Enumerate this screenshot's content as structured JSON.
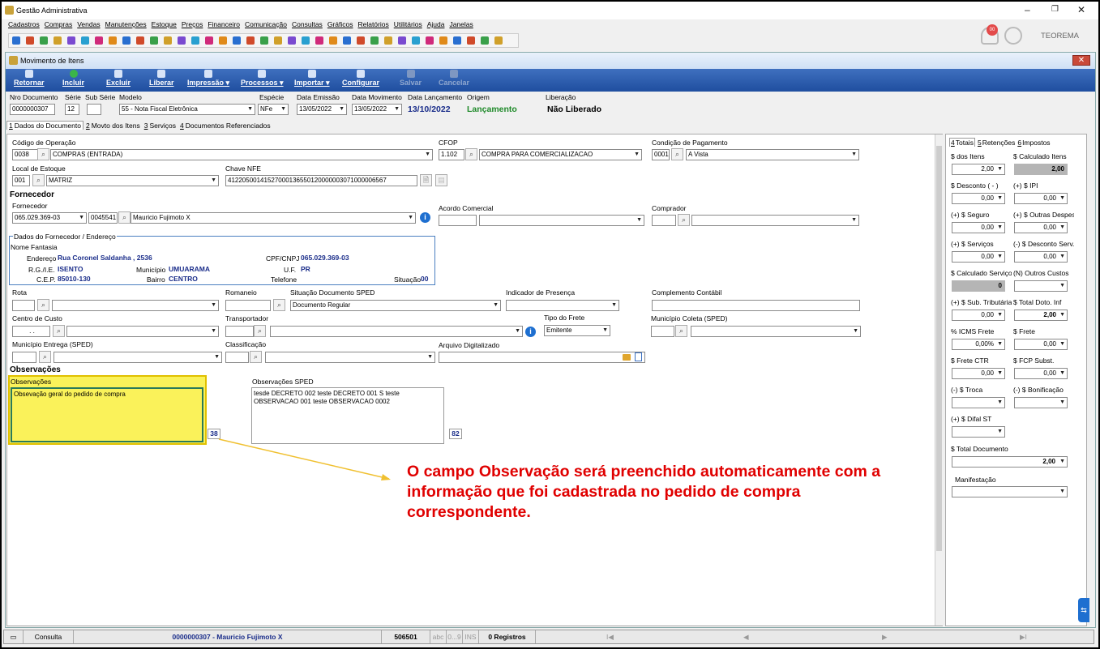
{
  "window": {
    "title": "Gestão Administrativa",
    "brand": "TEOREMA",
    "minimize": "–",
    "maximize": "❐",
    "close": "✕"
  },
  "menu": [
    "Cadastros",
    "Compras",
    "Vendas",
    "Manutenções",
    "Estoque",
    "Preços",
    "Financeiro",
    "Comunicação",
    "Consultas",
    "Gráficos",
    "Relatórios",
    "Utilitários",
    "Ajuda",
    "Janelas"
  ],
  "notif_badge": "00",
  "subwindow": {
    "title": "Movimento de Itens",
    "close": "✕"
  },
  "ribbon": {
    "retornar": "Retornar",
    "incluir": "Incluir",
    "excluir": "Excluir",
    "liberar": "Liberar",
    "impressao": "Impressão",
    "processos": "Processos",
    "importar": "Importar",
    "configurar": "Configurar",
    "salvar": "Salvar",
    "cancelar": "Cancelar"
  },
  "header": {
    "nro_label": "Nro Documento",
    "nro": "0000000307",
    "serie_label": "Série",
    "serie": "12",
    "subserie_label": "Sub Série",
    "subserie": "",
    "modelo_label": "Modelo",
    "modelo": "55 - Nota Fiscal Eletrônica",
    "especie_label": "Espécie",
    "especie": "NFe",
    "emissao_label": "Data Emissão",
    "emissao": "13/05/2022",
    "movimento_label": "Data Movimento",
    "movimento": "13/05/2022",
    "lancamento_label": "Data Lançamento",
    "lancamento": "13/10/2022",
    "origem_label": "Origem",
    "origem": "Lançamento",
    "liberacao_label": "Liberação",
    "liberacao": "Não Liberado"
  },
  "tabs": [
    {
      "key": "1",
      "label": "Dados do Documento"
    },
    {
      "key": "2",
      "label": "Movto dos Itens"
    },
    {
      "key": "3",
      "label": "Serviços"
    },
    {
      "key": "4",
      "label": "Documentos Referenciados"
    }
  ],
  "form": {
    "codop_label": "Código de Operação",
    "codop_code": "0038",
    "codop_desc": "COMPRAS (ENTRADA)",
    "cfop_label": "CFOP",
    "cfop_code": "1.102",
    "cfop_desc": "COMPRA PARA COMERCIALIZACAO",
    "condpag_label": "Condição de Pagamento",
    "condpag_code": "0001",
    "condpag_desc": "A Vista",
    "local_label": "Local de Estoque",
    "local_code": "001",
    "local_desc": "MATRIZ",
    "chave_label": "Chave NFE",
    "chave": "41220500141527000136550120000003071000006567",
    "fornecedor_title": "Fornecedor",
    "fornecedor_label": "Fornecedor",
    "forn_cnpj": "065.029.369-03",
    "forn_code": "0045541",
    "forn_name": "Mauricio Fujimoto X",
    "acordo_label": "Acordo Comercial",
    "comprador_label": "Comprador",
    "dados_title": "Dados do Fornecedor / Endereço",
    "nome_fantasia": "Nome Fantasia",
    "endereco_label": "Endereço",
    "endereco": "Rua Coronel Saldanha , 2536",
    "cpf_label": "CPF/CNPJ",
    "cpf": "065.029.369-03",
    "rg_label": "R.G./I.E.",
    "rg": "ISENTO",
    "municipio_label": "Município",
    "municipio": "UMUARAMA",
    "uf_label": "U.F.",
    "uf": "PR",
    "cep_label": "C.E.P.",
    "cep": "85010-130",
    "bairro_label": "Bairro",
    "bairro": "CENTRO",
    "telefone_label": "Telefone",
    "situacao_label": "Situação",
    "situacao": "00",
    "rota_label": "Rota",
    "romaneio_label": "Romaneio",
    "sitsped_label": "Situação Documento SPED",
    "sitsped": "Documento Regular",
    "indpres_label": "Indicador de Presença",
    "complemento_label": "Complemento Contábil",
    "ccusto_label": "Centro de Custo",
    "ccusto": ". .",
    "transp_label": "Transportador",
    "tipofrete_label": "Tipo do Frete",
    "tipofrete": "Emitente",
    "muncoleta_label": "Município Coleta (SPED)",
    "munentrega_label": "Município Entrega (SPED)",
    "classif_label": "Classificação",
    "arquivo_label": "Arquivo Digitalizado",
    "obs_title": "Observações",
    "obs_label": "Observações",
    "obs_text": "Obsevação geral do pedido de compra",
    "obs_count": "38",
    "obssped_label": "Observações SPED",
    "obssped_text": "tesde DECRETO 002 teste DECRETO 001 S   teste OBSERVACAO 001 teste OBSERVACAO 0002",
    "obssped_count": "82"
  },
  "annotation": "O campo Observação será preenchido automaticamente com a informação que foi cadastrada no pedido de compra correspondente.",
  "right": {
    "tabs": [
      {
        "key": "4",
        "label": "Totais"
      },
      {
        "key": "5",
        "label": "Retenções"
      },
      {
        "key": "6",
        "label": "Impostos"
      }
    ],
    "fields": [
      {
        "label": "$ dos Itens",
        "value": "2,00",
        "drop": true
      },
      {
        "label": "$ Calculado Itens",
        "value": "2,00",
        "readonly": true
      },
      {
        "label": "$ Desconto ( - )",
        "value": "0,00",
        "drop": true
      },
      {
        "label": "(+) $ IPI",
        "value": "0,00",
        "drop": true
      },
      {
        "label": "(+) $ Seguro",
        "value": "0,00",
        "drop": true
      },
      {
        "label": "(+) $ Outras Despesas",
        "value": "0,00",
        "drop": true
      },
      {
        "label": "(+) $ Serviços",
        "value": "0,00",
        "drop": true
      },
      {
        "label": "(-) $ Desconto Serv.",
        "value": "0,00",
        "drop": true
      },
      {
        "label": "$ Calculado Serviços",
        "value": "0",
        "readonly": true
      },
      {
        "label": "(N) Outros Custos",
        "value": "",
        "drop": true
      },
      {
        "label": "(+) $ Sub. Tributária",
        "value": "0,00",
        "drop": true
      },
      {
        "label": "$ Total Doto. Inf",
        "value": "2,00",
        "drop": true,
        "bold": true
      },
      {
        "label": "% ICMS Frete",
        "value": "0,00%",
        "drop": true
      },
      {
        "label": "$ Frete",
        "value": "0,00",
        "drop": true
      },
      {
        "label": "$ Frete CTR",
        "value": "0,00",
        "drop": true
      },
      {
        "label": "$ FCP Subst.",
        "value": "0,00",
        "drop": true
      },
      {
        "label": "(-) $ Troca",
        "value": "",
        "drop": true
      },
      {
        "label": "(-) $ Bonificação",
        "value": "",
        "drop": true
      },
      {
        "label": "(+) $ Difal ST",
        "value": "",
        "drop": true
      }
    ],
    "total_label": "$ Total Documento",
    "total": "2,00",
    "manif_label": "Manifestação"
  },
  "status": {
    "mode": "Consulta",
    "doc": "0000000307 - Mauricio Fujimoto X",
    "code": "506501",
    "abc": "abc",
    "nums": "0...9",
    "ins": "INS",
    "registros": "0 Registros",
    "nav_first": "I◀",
    "nav_prev": "◀",
    "nav_next": "▶",
    "nav_last": "▶I"
  }
}
